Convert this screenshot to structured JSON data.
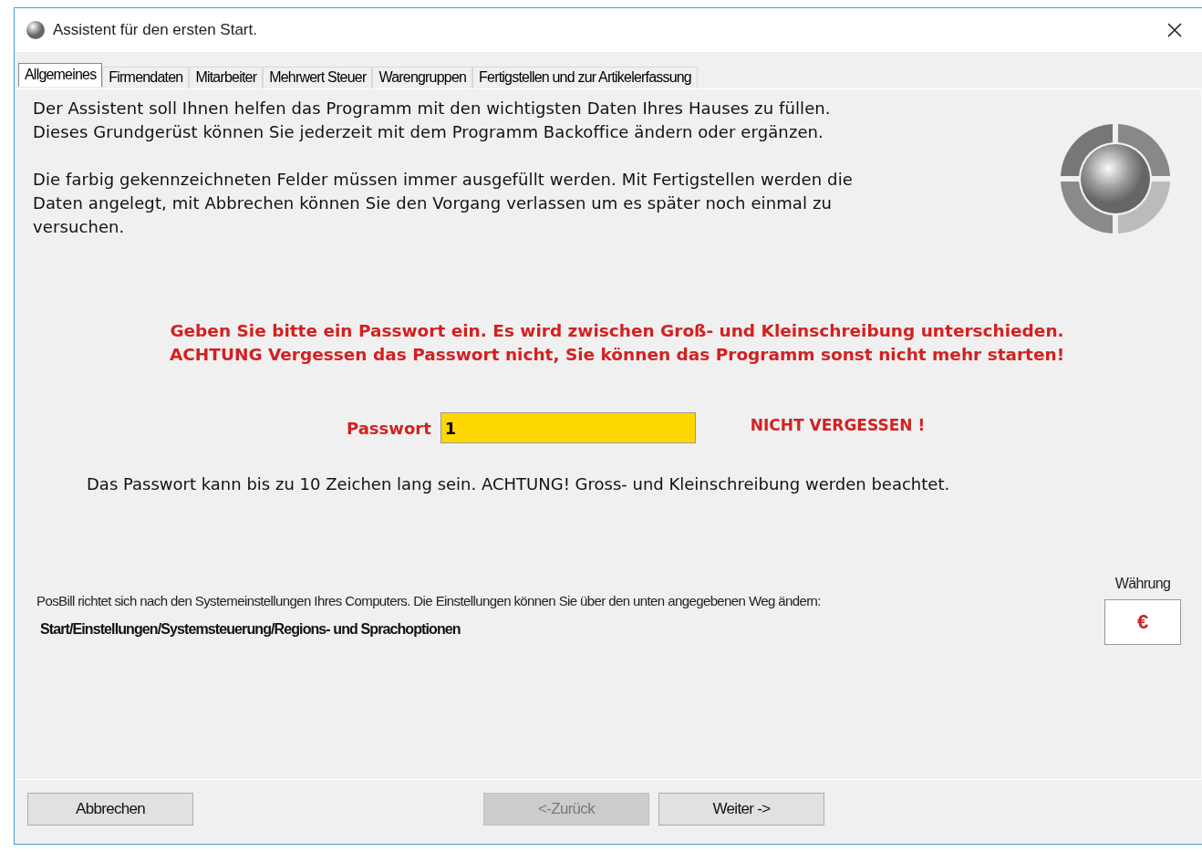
{
  "window": {
    "title": "Assistent für den ersten Start."
  },
  "tabs": [
    {
      "label": "Allgemeines",
      "selected": true
    },
    {
      "label": "Firmendaten",
      "selected": false
    },
    {
      "label": "Mitarbeiter",
      "selected": false
    },
    {
      "label": "Mehrwert Steuer",
      "selected": false
    },
    {
      "label": "Warengruppen",
      "selected": false
    },
    {
      "label": "Fertigstellen und zur Artikelerfassung",
      "selected": false
    }
  ],
  "intro": [
    [
      "Der Assistent soll Ihnen helfen das Programm mit den wichtigsten Daten Ihres Hauses zu füllen.",
      "Dieses Grundgerüst können Sie jederzeit mit dem Programm Backoffice ändern oder ergänzen."
    ],
    [
      "Die farbig gekennzeichneten Felder müssen immer ausgefüllt werden. Mit Fertigstellen werden die",
      "Daten angelegt, mit Abbrechen können Sie den Vorgang verlassen um es später noch einmal zu",
      "versuchen."
    ]
  ],
  "warning": [
    "Geben Sie bitte ein Passwort ein. Es wird zwischen Groß- und Kleinschreibung unterschieden.",
    "ACHTUNG Vergessen das Passwort nicht, Sie können das Programm sonst nicht mehr starten!"
  ],
  "password": {
    "label": "Passwort",
    "value": "1",
    "reminder": "NICHT VERGESSEN !"
  },
  "hint": "Das Passwort kann bis zu 10 Zeichen lang sein. ACHTUNG! Gross- und Kleinschreibung werden beachtet.",
  "regional": {
    "text": "PosBill richtet sich nach den Systemeinstellungen Ihres Computers. Die Einstellungen können Sie über den unten angegebenen Weg ändern:",
    "path": "Start/Einstellungen/Systemsteuerung/Regions- und Sprachoptionen"
  },
  "currency": {
    "label": "Währung",
    "value": "€"
  },
  "buttons": [
    {
      "label": "Abbrechen",
      "disabled": false
    },
    {
      "label": "<-Zurück",
      "disabled": true
    },
    {
      "label": "Weiter ->",
      "disabled": false
    }
  ]
}
